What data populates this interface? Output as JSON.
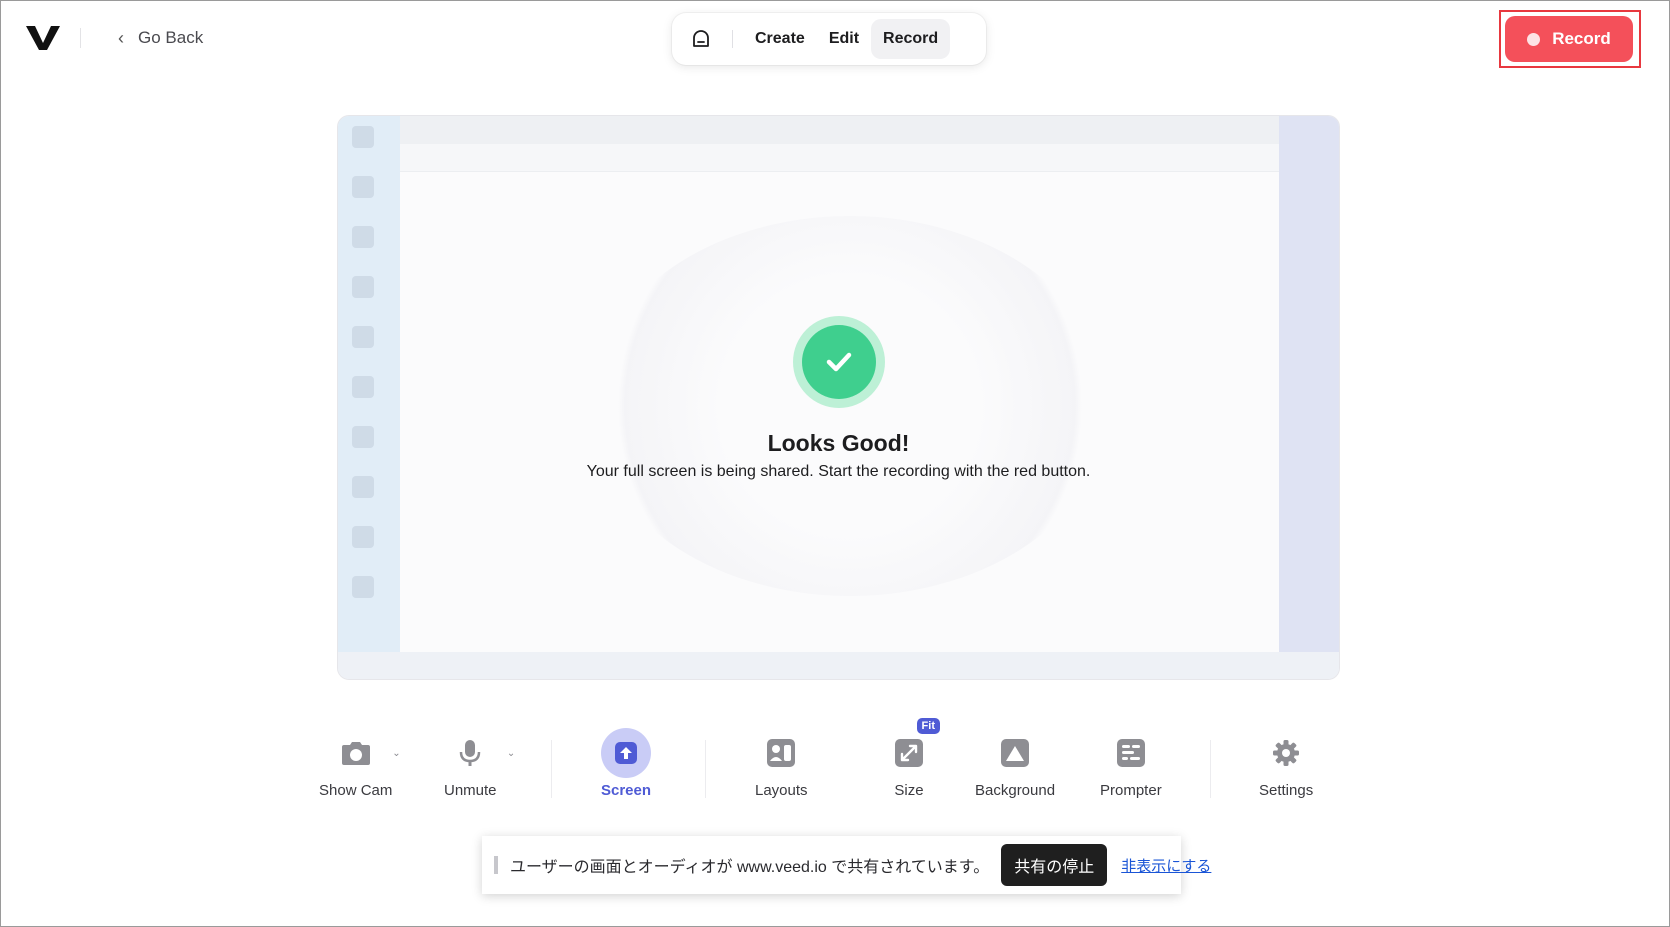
{
  "header": {
    "go_back_label": "Go Back",
    "modes": [
      {
        "label": "Create"
      },
      {
        "label": "Edit"
      },
      {
        "label": "Record"
      }
    ],
    "active_mode": "Record",
    "record_button_label": "Record"
  },
  "preview": {
    "status_title": "Looks Good!",
    "status_message": "Your full screen is being shared. Start the recording with the red button."
  },
  "toolbar": {
    "items": [
      {
        "label": "Show Cam",
        "icon": "camera-icon"
      },
      {
        "label": "Unmute",
        "icon": "microphone-icon"
      },
      {
        "label": "Screen",
        "icon": "screen-share-icon",
        "active": true
      },
      {
        "label": "Layouts",
        "icon": "layouts-icon"
      },
      {
        "label": "Size",
        "icon": "resize-icon",
        "badge": "Fit"
      },
      {
        "label": "Background",
        "icon": "image-icon"
      },
      {
        "label": "Prompter",
        "icon": "prompter-icon"
      },
      {
        "label": "Settings",
        "icon": "gear-icon"
      }
    ]
  },
  "share_banner": {
    "message": "ユーザーの画面とオーディオが www.veed.io で共有されています。",
    "stop_label": "共有の停止",
    "hide_label": "非表示にする"
  },
  "colors": {
    "record_red": "#f4505a",
    "accent_indigo": "#4f5bd5",
    "success_green": "#3fcf8e"
  }
}
